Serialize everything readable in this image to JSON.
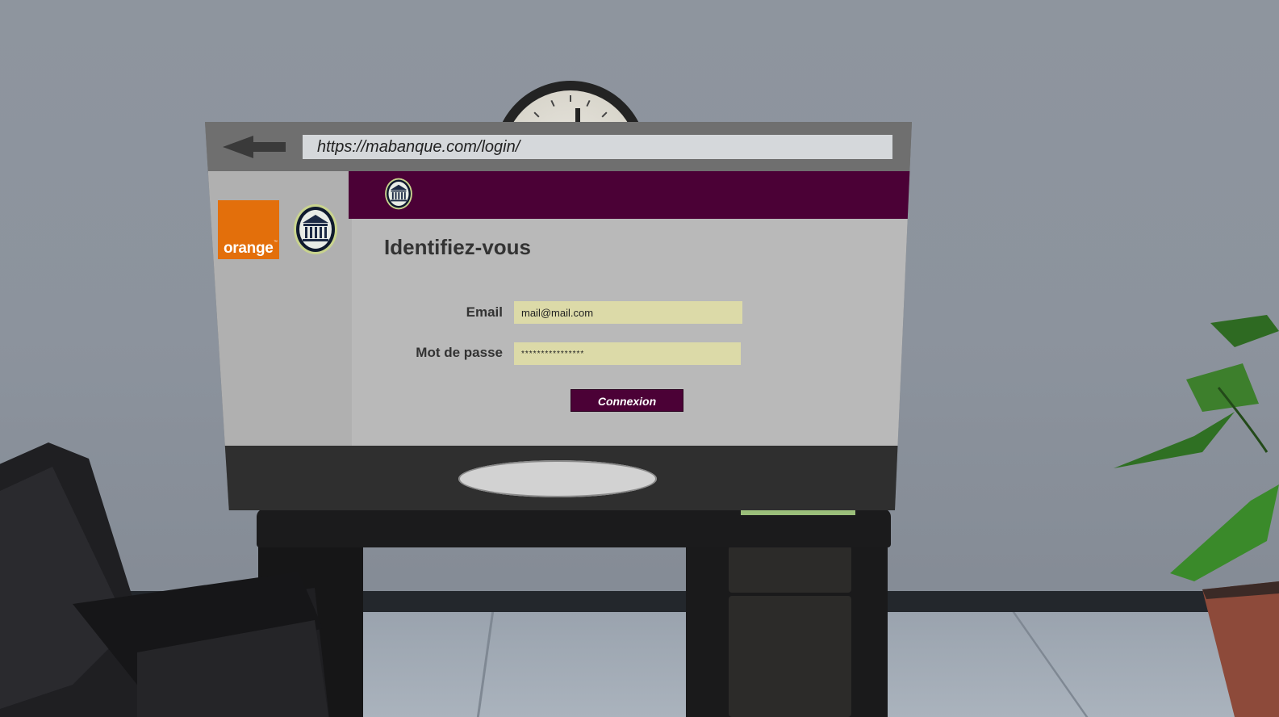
{
  "browser": {
    "url": "https://mabanque.com/login/"
  },
  "sidebar": {
    "brand_logo_text": "orange",
    "brand_logo_tm": "™"
  },
  "login_page": {
    "title": "Identifiez-vous",
    "email_label": "Email",
    "email_value": "mail@mail.com",
    "password_label": "Mot de passe",
    "password_value": "****************",
    "submit_label": "Connexion"
  },
  "colors": {
    "header_band": "#4b0136",
    "brand_orange": "#e36f0b",
    "input_background": "#dcdaa8",
    "content_background": "#b9b9b9"
  },
  "icons": {
    "back": "left-arrow-icon",
    "bank": "bank-building-icon"
  }
}
